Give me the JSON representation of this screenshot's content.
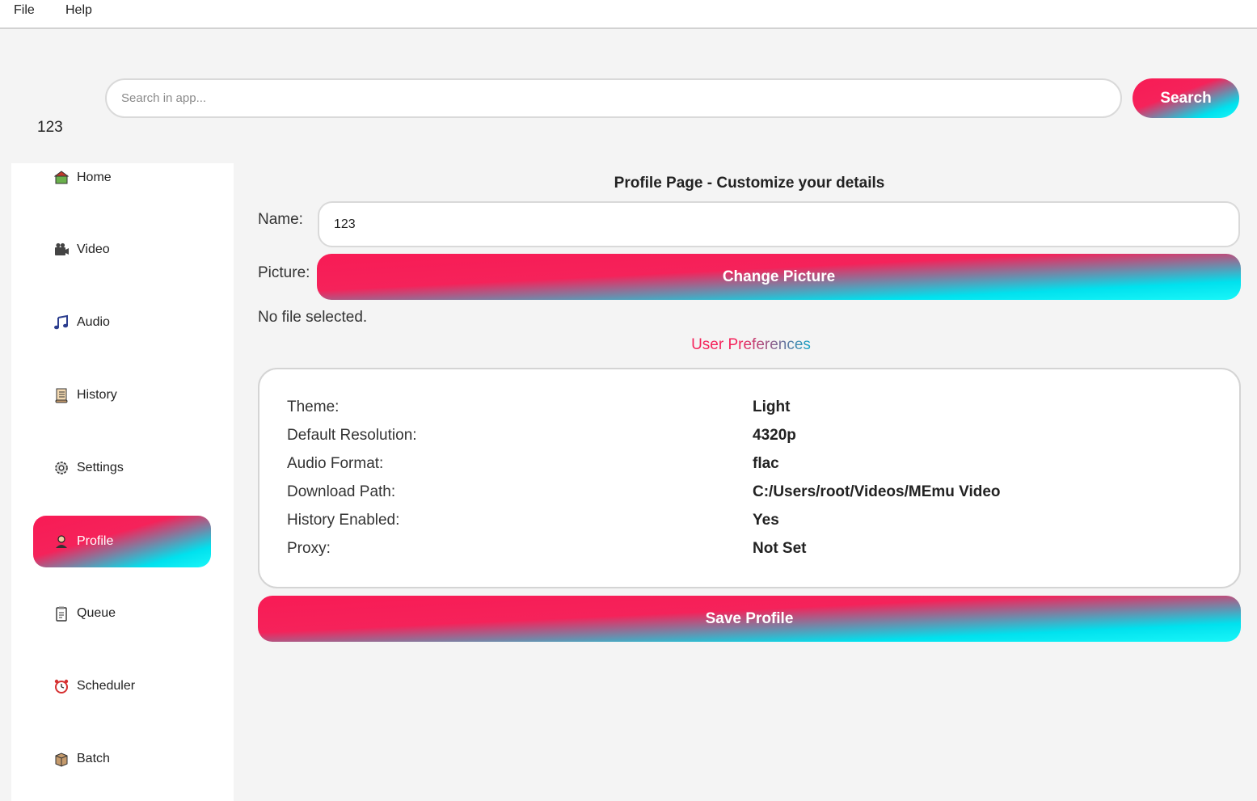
{
  "menubar": {
    "items": [
      "File",
      "Help"
    ]
  },
  "search": {
    "placeholder": "Search in app...",
    "button_label": "Search"
  },
  "user": {
    "name": "123"
  },
  "sidebar": {
    "items": [
      {
        "label": "Home",
        "icon": "home-icon"
      },
      {
        "label": "Video",
        "icon": "video-camera-icon"
      },
      {
        "label": "Audio",
        "icon": "music-note-icon"
      },
      {
        "label": "History",
        "icon": "scroll-icon"
      },
      {
        "label": "Settings",
        "icon": "gear-icon"
      },
      {
        "label": "Profile",
        "icon": "person-icon",
        "active": true
      },
      {
        "label": "Queue",
        "icon": "clipboard-icon"
      },
      {
        "label": "Scheduler",
        "icon": "alarm-clock-icon"
      },
      {
        "label": "Batch",
        "icon": "package-icon"
      }
    ]
  },
  "profile": {
    "title": "Profile Page - Customize your details",
    "name_label": "Name:",
    "name_value": "123",
    "picture_label": "Picture:",
    "change_picture_label": "Change Picture",
    "file_status": "No file selected.",
    "preferences_title": "User Preferences",
    "preferences": [
      {
        "key": "Theme:",
        "value": "Light"
      },
      {
        "key": "Default Resolution:",
        "value": "4320p"
      },
      {
        "key": "Audio Format:",
        "value": "flac"
      },
      {
        "key": "Download Path:",
        "value": "C:/Users/root/Videos/MEmu Video"
      },
      {
        "key": "History Enabled:",
        "value": "Yes"
      },
      {
        "key": "Proxy:",
        "value": "Not Set"
      }
    ],
    "save_label": "Save Profile"
  },
  "colors": {
    "gradient_start": "#f81b55",
    "gradient_end": "#19f6f8",
    "background": "#f4f4f4"
  }
}
